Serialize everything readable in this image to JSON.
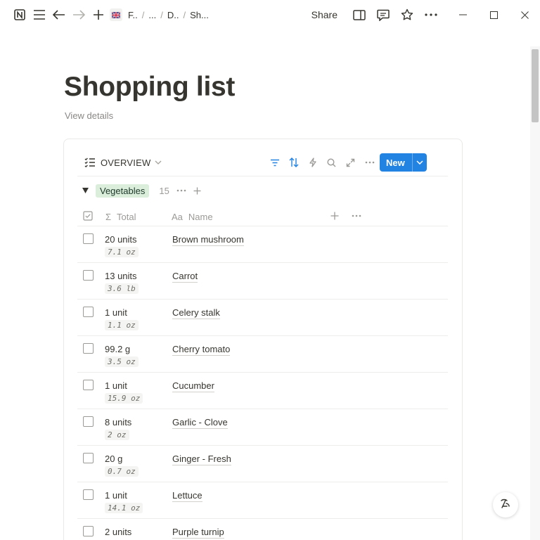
{
  "topbar": {
    "breadcrumbs": [
      "F..",
      "...",
      "D..",
      "Sh..."
    ],
    "share_label": "Share"
  },
  "page": {
    "title": "Shopping list",
    "view_details": "View details"
  },
  "database": {
    "view_name": "OVERVIEW",
    "new_label": "New",
    "group": {
      "name": "Vegetables",
      "count": "15"
    },
    "columns": {
      "total": "Total",
      "name": "Name",
      "name_prefix": "Aa",
      "total_prefix": "Σ"
    },
    "rows": [
      {
        "total": "20 units",
        "conversion": "7.1 oz",
        "name": "Brown mushroom"
      },
      {
        "total": "13 units",
        "conversion": "3.6 lb",
        "name": "Carrot"
      },
      {
        "total": "1 unit",
        "conversion": "1.1 oz",
        "name": "Celery stalk"
      },
      {
        "total": "99.2 g",
        "conversion": "3.5 oz",
        "name": "Cherry tomato"
      },
      {
        "total": "1 unit",
        "conversion": "15.9 oz",
        "name": "Cucumber"
      },
      {
        "total": "8 units",
        "conversion": "2 oz",
        "name": "Garlic - Clove"
      },
      {
        "total": "20 g",
        "conversion": "0.7 oz",
        "name": "Ginger - Fresh"
      },
      {
        "total": "1 unit",
        "conversion": "14.1 oz",
        "name": "Lettuce"
      },
      {
        "total": "2 units",
        "conversion": "",
        "name": "Purple turnip"
      }
    ]
  },
  "colors": {
    "accent": "#2383e2",
    "group_tag_bg": "#dbeddb",
    "group_tag_text": "#1c3829",
    "text": "#37352f",
    "muted": "#9b9a97"
  }
}
